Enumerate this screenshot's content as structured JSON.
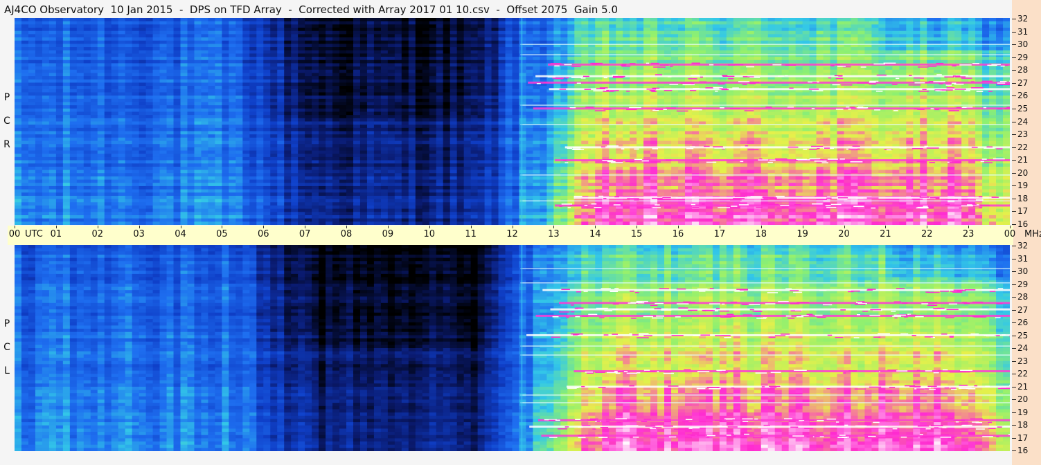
{
  "header": {
    "title": "AJ4CO Observatory  10 Jan 2015  -  DPS on TFD Array  -  Corrected with Array 2017 01 10.csv  -  Offset 2075  Gain 5.0"
  },
  "colors": {
    "background": "#f5f5f5",
    "time_axis_band": "#ffffcc",
    "frequency_axis_band": "#fbe0c8",
    "colormap": [
      "#000000",
      "#0a1a6e",
      "#0f3fc8",
      "#1e6ef0",
      "#33c8e8",
      "#8ef070",
      "#e6f04a",
      "#ff2bd0",
      "#ffffff"
    ]
  },
  "chart_data": {
    "type": "heatmap",
    "title": "AJ4CO Observatory  10 Jan 2015  -  DPS on TFD Array  -  Corrected with Array 2017 01 10.csv  -  Offset 2075  Gain 5.0",
    "x_unit": "UTC",
    "y_unit": "MHz",
    "x_ticks": [
      "00",
      "01",
      "02",
      "03",
      "04",
      "05",
      "06",
      "07",
      "08",
      "09",
      "10",
      "11",
      "12",
      "13",
      "14",
      "15",
      "16",
      "17",
      "18",
      "19",
      "20",
      "21",
      "22",
      "23",
      "00"
    ],
    "xlim": [
      0,
      24
    ],
    "y_ticks": [
      16,
      17,
      18,
      19,
      20,
      21,
      22,
      23,
      24,
      25,
      26,
      27,
      28,
      29,
      30,
      31,
      32
    ],
    "ylim": [
      16,
      32
    ],
    "panels": [
      {
        "name": "RCP",
        "label_letters": [
          "P",
          "C",
          "R"
        ],
        "night_depth": 0.9,
        "strong_bands_mhz": [
          17.5,
          18.1,
          21.0,
          22.0,
          25.0,
          26.5,
          27.0,
          27.5,
          28.4
        ],
        "lines_mhz": [
          17.9,
          19.9,
          23.8,
          25.3,
          29.2,
          30.0
        ]
      },
      {
        "name": "LCP",
        "label_letters": [
          "P",
          "C",
          "L"
        ],
        "night_depth": 1.0,
        "strong_bands_mhz": [
          17.2,
          17.9,
          18.4,
          21.0,
          22.2,
          25.0,
          26.5,
          27.0,
          27.5,
          28.5
        ],
        "lines_mhz": [
          19.8,
          20.4,
          23.5,
          24.2,
          29.1,
          30.2
        ]
      }
    ]
  }
}
